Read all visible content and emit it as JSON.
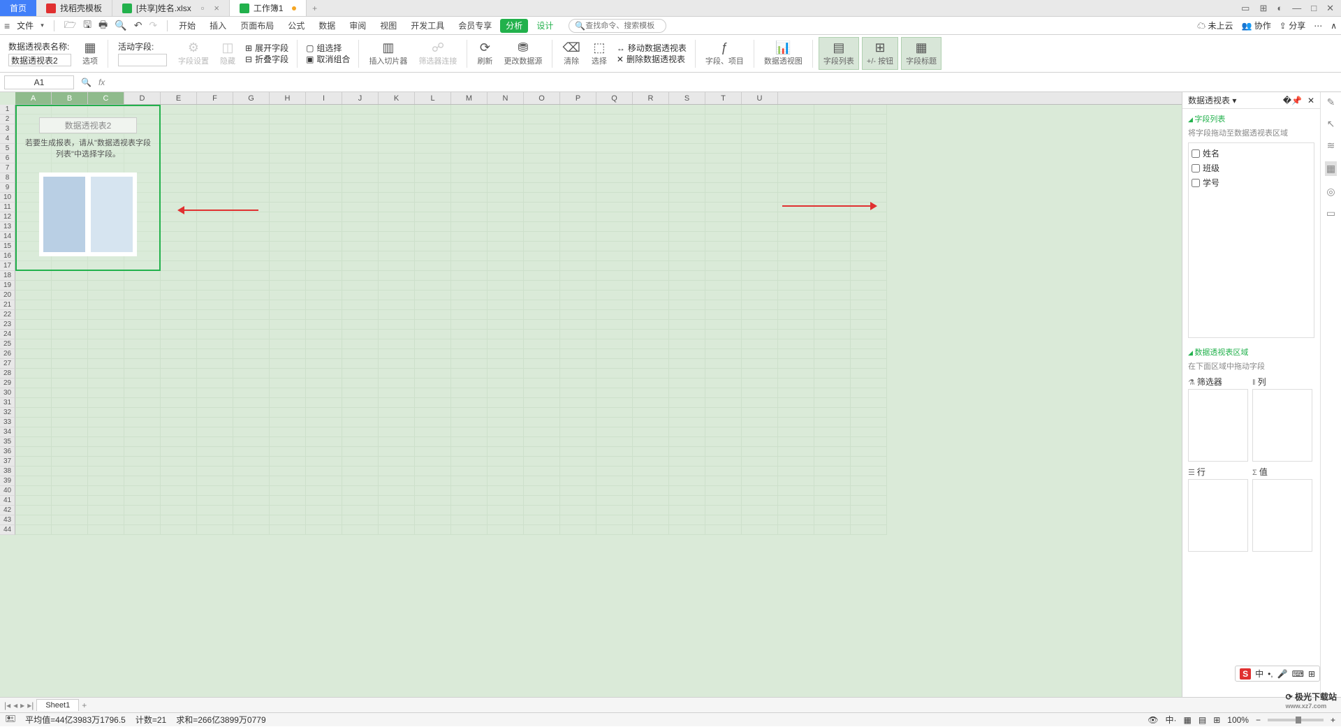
{
  "tabs": {
    "home": "首页",
    "t1": "找稻壳模板",
    "t2": "[共享]姓名.xlsx",
    "t3": "工作簿1"
  },
  "menu": {
    "file": "文件",
    "start": "开始",
    "insert": "插入",
    "layout": "页面布局",
    "formula": "公式",
    "data": "数据",
    "review": "审阅",
    "view": "视图",
    "dev": "开发工具",
    "member": "会员专享",
    "analysis": "分析",
    "design": "设计",
    "searchPh": "查找命令、搜索模板"
  },
  "cloud": {
    "notup": "未上云",
    "collab": "协作",
    "share": "分享"
  },
  "ribbon": {
    "nameLbl": "数据透视表名称:",
    "nameVal": "数据透视表2",
    "options": "选项",
    "activeField": "活动字段:",
    "fieldSet": "字段设置",
    "hide": "隐藏",
    "expand": "展开字段",
    "collapse": "折叠字段",
    "grpsel": "组选择",
    "ungrp": "取消组合",
    "slicer": "插入切片器",
    "filterConn": "筛选器连接",
    "refresh": "刷新",
    "chgsrc": "更改数据源",
    "clear": "清除",
    "select": "选择",
    "move": "移动数据透视表",
    "delete": "删除数据透视表",
    "fields": "字段、项目",
    "chart": "数据透视图",
    "fieldlist": "字段列表",
    "pmbuttons": "+/- 按钮",
    "fieldhdr": "字段标题"
  },
  "cellref": "A1",
  "cols": [
    "A",
    "B",
    "C",
    "D",
    "E",
    "F",
    "G",
    "H",
    "I",
    "J",
    "K",
    "L",
    "M",
    "N",
    "O",
    "P",
    "Q",
    "R",
    "S",
    "T",
    "U"
  ],
  "pivot": {
    "title": "数据透视表2",
    "msg": "若要生成报表，请从\"数据透视表字段列表\"中选择字段。"
  },
  "panel": {
    "title": "数据透视表",
    "sec1": "字段列表",
    "hint1": "将字段拖动至数据透视表区域",
    "fields": [
      "姓名",
      "班级",
      "学号"
    ],
    "sec2": "数据透视表区域",
    "hint2": "在下面区域中拖动字段",
    "filter": "筛选器",
    "cols": "列",
    "rows": "行",
    "vals": "值"
  },
  "sheet": "Sheet1",
  "status": {
    "avg": "平均值=44亿3983万1796.5",
    "cnt": "计数=21",
    "sum": "求和=266亿3899万0779",
    "zoom": "100%"
  },
  "ime": {
    "zh": "中"
  },
  "watermark": {
    "name": "极光下载站",
    "url": "www.xz7.com"
  }
}
